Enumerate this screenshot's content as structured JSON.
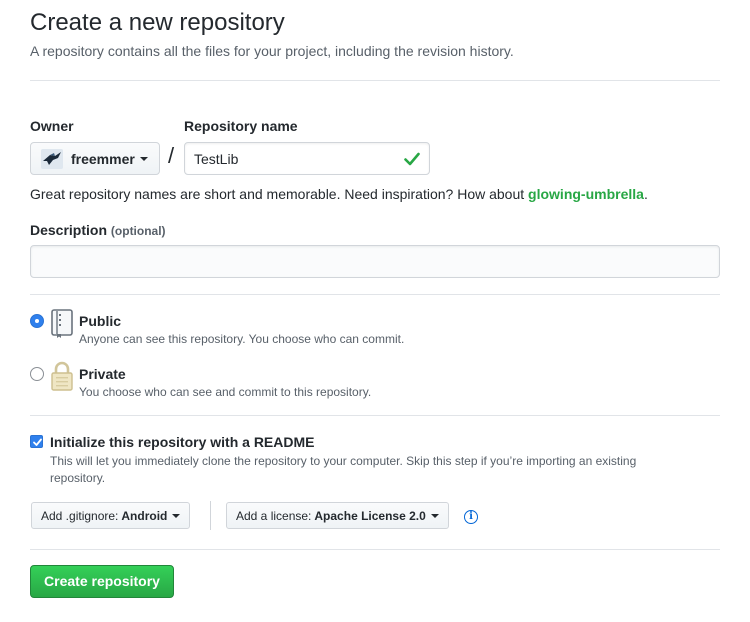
{
  "header": {
    "title": "Create a new repository",
    "subtitle": "A repository contains all the files for your project, including the revision history."
  },
  "owner": {
    "label": "Owner",
    "value": "freemmer"
  },
  "slash": "/",
  "repo_name": {
    "label": "Repository name",
    "value": "TestLib"
  },
  "hint": {
    "prefix": "Great repository names are short and memorable. Need inspiration? How about ",
    "suggestion": "glowing-umbrella",
    "suffix": "."
  },
  "description": {
    "label": "Description",
    "optional": "(optional)",
    "value": ""
  },
  "visibility": {
    "selected": "public",
    "public": {
      "title": "Public",
      "note": "Anyone can see this repository. You choose who can commit."
    },
    "private": {
      "title": "Private",
      "note": "You choose who can see and commit to this repository."
    }
  },
  "readme": {
    "checked": true,
    "label": "Initialize this repository with a README",
    "note": "This will let you immediately clone the repository to your computer. Skip this step if you’re importing an existing repository."
  },
  "gitignore": {
    "prefix": "Add .gitignore:",
    "value": "Android"
  },
  "license": {
    "prefix": "Add a license:",
    "value": "Apache License 2.0"
  },
  "submit": {
    "label": "Create repository"
  },
  "icons": {
    "valid": "check-icon",
    "public": "repo-book-icon",
    "private": "lock-icon",
    "info": "info-icon"
  },
  "colors": {
    "accent": "#28a745",
    "link": "#0366d6",
    "radio": "#2f80ed"
  }
}
